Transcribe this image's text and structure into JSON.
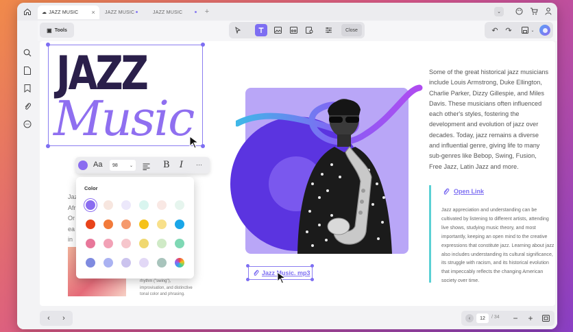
{
  "tabs": [
    {
      "label": "JAZZ MUSIC",
      "active": true
    },
    {
      "label": "JAZZ MUSIC",
      "active": false
    },
    {
      "label": "JAZZ MUSIC",
      "active": false
    }
  ],
  "toolbar": {
    "tools_label": "Tools",
    "close_label": "Close"
  },
  "heading": {
    "line1": "JAZZ",
    "line2": "Music"
  },
  "text_toolbar": {
    "font_size": "98",
    "font_label": "Aa",
    "bold": "B",
    "italic": "I",
    "more": "···"
  },
  "color_panel": {
    "title": "Color",
    "swatches": [
      "#8a6cf0",
      "#f7e6df",
      "#ece8fb",
      "#d9f5ef",
      "#f9e8e4",
      "#e6f5ee",
      "#e8431a",
      "#f27a3a",
      "#f59a6e",
      "#f5c21a",
      "#f8e08a",
      "#1aa6e8",
      "#e8779a",
      "#f2a1b6",
      "#f6c6cc",
      "#f0d870",
      "#cfeac6",
      "#7fd8b4",
      "#7f8be0",
      "#aab2f2",
      "#cbc3ee",
      "#e2d8f6",
      "#a8c4bc",
      "#conic"
    ]
  },
  "body_text": "Some of the great historical jazz musicians include Louis Armstrong, Duke Ellington, Charlie Parker, Dizzy Gillespie, and Miles Davis. These musicians often influenced each other's styles, fostering the development and evolution of jazz over decades. Today, jazz remains a diverse and influential genre, giving life to many sub-genres like Bebop, Swing, Fusion, Free Jazz, Latin Jazz and more.",
  "link_label": "Open Link",
  "small_text": "Jazz appreciation and understanding can be cultivated by listening to different artists, attending live shows, studying music theory, and most importantly, keeping an open mind to the creative expressions that constitute jazz. Learning about jazz also includes understanding its cultural significance, its struggle with racism, and its historical evolution that impeccably reflects the changing American society over time.",
  "partial_lines": [
    "Jaz",
    "Afr",
    "Or",
    "ea",
    "in",
    "ae"
  ],
  "caption": [
    "rhythm (\"swing\"),",
    "improvisation, and distinctive",
    "tonal color and phrasing."
  ],
  "audio_label": "Jazz Music. mp3",
  "pagination": {
    "current": "12",
    "total": "/ 34"
  },
  "colors": {
    "accent": "#7d6ef2",
    "teal": "#5ad0d4",
    "heading": "#2a1f4a",
    "music": "#8f6ff0"
  }
}
